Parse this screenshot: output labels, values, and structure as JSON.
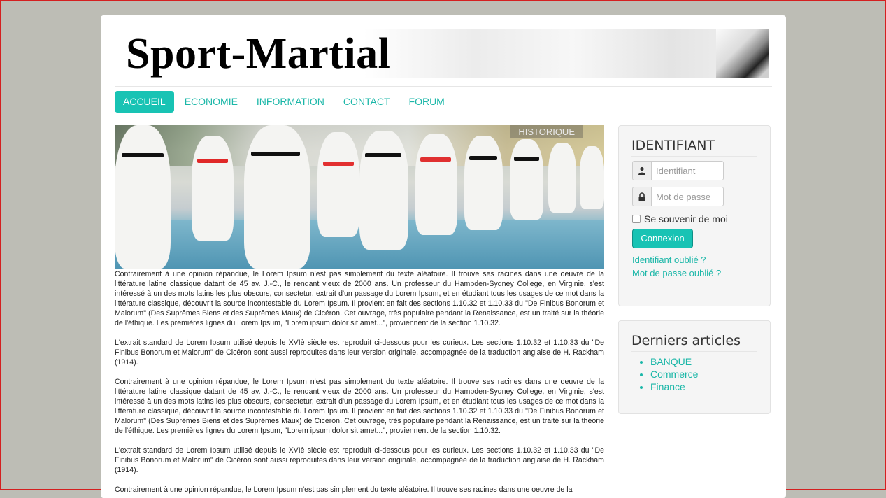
{
  "site": {
    "title": "Sport-Martial"
  },
  "nav": {
    "items": [
      {
        "label": "ACCUEIL",
        "active": true
      },
      {
        "label": "ECONOMIE",
        "active": false
      },
      {
        "label": "INFORMATION",
        "active": false
      },
      {
        "label": "CONTACT",
        "active": false
      },
      {
        "label": "FORUM",
        "active": false
      }
    ]
  },
  "hero": {
    "badge": "HISTORIQUE"
  },
  "content": {
    "paragraphs": [
      "Contrairement à une opinion répandue, le Lorem Ipsum n'est pas simplement du texte aléatoire. Il trouve ses racines dans une oeuvre de la littérature latine classique datant de 45 av. J.-C., le rendant vieux de 2000 ans. Un professeur du Hampden-Sydney College, en Virginie, s'est intéressé à un des mots latins les plus obscurs, consectetur, extrait d'un passage du Lorem Ipsum, et en étudiant tous les usages de ce mot dans la littérature classique, découvrit la source incontestable du Lorem Ipsum. Il provient en fait des sections 1.10.32 et 1.10.33 du \"De Finibus Bonorum et Malorum\" (Des Suprêmes Biens et des Suprêmes Maux) de Cicéron. Cet ouvrage, très populaire pendant la Renaissance, est un traité sur la théorie de l'éthique. Les premières lignes du Lorem Ipsum, \"Lorem ipsum dolor sit amet...\", proviennent de la section 1.10.32.",
      "L'extrait standard de Lorem Ipsum utilisé depuis le XVIè siècle est reproduit ci-dessous pour les curieux. Les sections 1.10.32 et 1.10.33 du \"De Finibus Bonorum et Malorum\" de Cicéron sont aussi reproduites dans leur version originale, accompagnée de la traduction anglaise de H. Rackham (1914).",
      "Contrairement à une opinion répandue, le Lorem Ipsum n'est pas simplement du texte aléatoire. Il trouve ses racines dans une oeuvre de la littérature latine classique datant de 45 av. J.-C., le rendant vieux de 2000 ans. Un professeur du Hampden-Sydney College, en Virginie, s'est intéressé à un des mots latins les plus obscurs, consectetur, extrait d'un passage du Lorem Ipsum, et en étudiant tous les usages de ce mot dans la littérature classique, découvrit la source incontestable du Lorem Ipsum. Il provient en fait des sections 1.10.32 et 1.10.33 du \"De Finibus Bonorum et Malorum\" (Des Suprêmes Biens et des Suprêmes Maux) de Cicéron. Cet ouvrage, très populaire pendant la Renaissance, est un traité sur la théorie de l'éthique. Les premières lignes du Lorem Ipsum, \"Lorem ipsum dolor sit amet...\", proviennent de la section 1.10.32.",
      "L'extrait standard de Lorem Ipsum utilisé depuis le XVIè siècle est reproduit ci-dessous pour les curieux. Les sections 1.10.32 et 1.10.33 du \"De Finibus Bonorum et Malorum\" de Cicéron sont aussi reproduites dans leur version originale, accompagnée de la traduction anglaise de H. Rackham (1914).",
      "Contrairement à une opinion répandue, le Lorem Ipsum n'est pas simplement du texte aléatoire. Il trouve ses racines dans une oeuvre de la"
    ]
  },
  "login": {
    "title": "IDENTIFIANT",
    "username_placeholder": "Identifiant",
    "username_icon": "user-icon",
    "password_placeholder": "Mot de passe",
    "password_icon": "lock-icon",
    "remember_label": "Se souvenir de moi",
    "submit_label": "Connexion",
    "forgot_username": "Identifiant oublié ?",
    "forgot_password": "Mot de passe oublié ?"
  },
  "articles": {
    "title": "Derniers articles",
    "items": [
      "BANQUE",
      "Commerce",
      "Finance"
    ]
  },
  "colors": {
    "accent": "#18c3b4",
    "link": "#1bb7a8",
    "background": "#bdbdb5"
  }
}
